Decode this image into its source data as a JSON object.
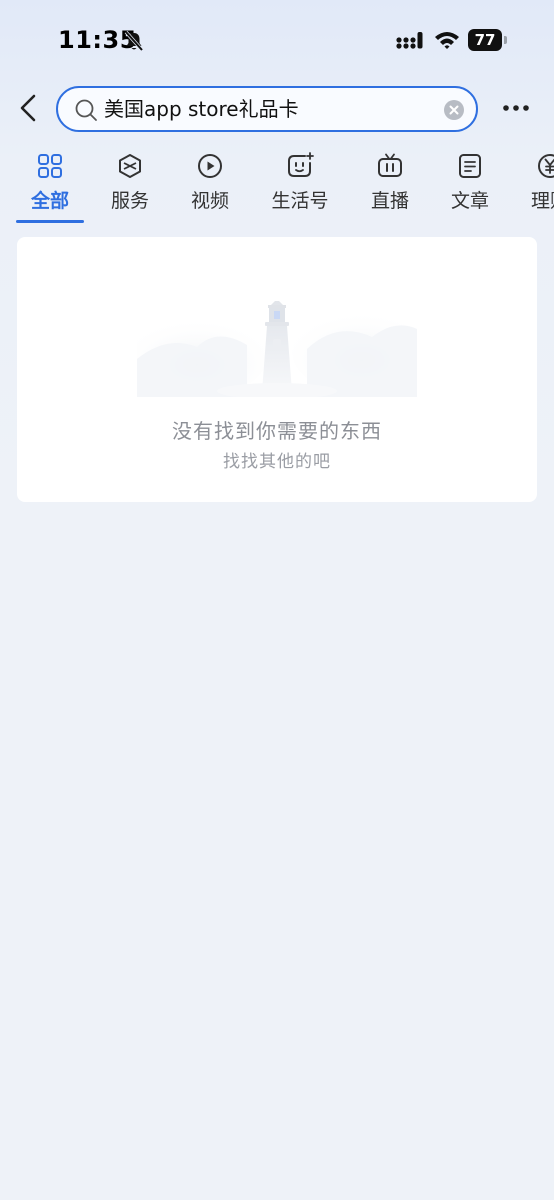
{
  "status_bar": {
    "time": "11:35",
    "battery": "77"
  },
  "search": {
    "query": "美国app store礼品卡"
  },
  "tabs": [
    {
      "label": "全部",
      "icon": "grid-icon",
      "active": true
    },
    {
      "label": "服务",
      "icon": "service-cube-icon",
      "active": false
    },
    {
      "label": "视频",
      "icon": "play-circle-icon",
      "active": false
    },
    {
      "label": "生活号",
      "icon": "life-account-icon",
      "active": false
    },
    {
      "label": "直播",
      "icon": "tv-live-icon",
      "active": false
    },
    {
      "label": "文章",
      "icon": "article-icon",
      "active": false
    },
    {
      "label": "理财",
      "icon": "yuan-coin-icon",
      "active": false
    }
  ],
  "empty_state": {
    "title": "没有找到你需要的东西",
    "subtitle": "找找其他的吧",
    "icon": "lighthouse-icon"
  },
  "colors": {
    "accent": "#2f6fe0",
    "background": "#eef2f8",
    "card": "#ffffff",
    "muted_text": "#8c8f96"
  }
}
